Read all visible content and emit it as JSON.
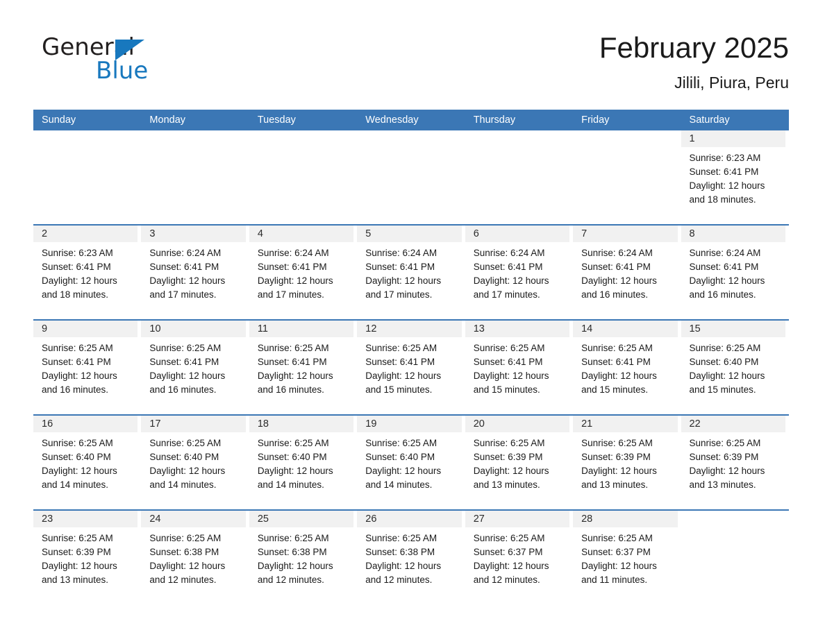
{
  "brand": {
    "name_part1": "General",
    "name_part2": "Blue",
    "logo_icon": "triangle-flag-icon",
    "blue": "#1878be"
  },
  "header": {
    "title": "February 2025",
    "subtitle": "Jilili, Piura, Peru"
  },
  "theme": {
    "header_blue": "#3b77b5",
    "day_strip_gray": "#f1f1f1",
    "text": "#1a1a1a"
  },
  "weekdays": [
    "Sunday",
    "Monday",
    "Tuesday",
    "Wednesday",
    "Thursday",
    "Friday",
    "Saturday"
  ],
  "weeks": [
    [
      {
        "day": "",
        "sunrise": "",
        "sunset": "",
        "daylight1": "",
        "daylight2": ""
      },
      {
        "day": "",
        "sunrise": "",
        "sunset": "",
        "daylight1": "",
        "daylight2": ""
      },
      {
        "day": "",
        "sunrise": "",
        "sunset": "",
        "daylight1": "",
        "daylight2": ""
      },
      {
        "day": "",
        "sunrise": "",
        "sunset": "",
        "daylight1": "",
        "daylight2": ""
      },
      {
        "day": "",
        "sunrise": "",
        "sunset": "",
        "daylight1": "",
        "daylight2": ""
      },
      {
        "day": "",
        "sunrise": "",
        "sunset": "",
        "daylight1": "",
        "daylight2": ""
      },
      {
        "day": "1",
        "sunrise": "Sunrise: 6:23 AM",
        "sunset": "Sunset: 6:41 PM",
        "daylight1": "Daylight: 12 hours",
        "daylight2": "and 18 minutes."
      }
    ],
    [
      {
        "day": "2",
        "sunrise": "Sunrise: 6:23 AM",
        "sunset": "Sunset: 6:41 PM",
        "daylight1": "Daylight: 12 hours",
        "daylight2": "and 18 minutes."
      },
      {
        "day": "3",
        "sunrise": "Sunrise: 6:24 AM",
        "sunset": "Sunset: 6:41 PM",
        "daylight1": "Daylight: 12 hours",
        "daylight2": "and 17 minutes."
      },
      {
        "day": "4",
        "sunrise": "Sunrise: 6:24 AM",
        "sunset": "Sunset: 6:41 PM",
        "daylight1": "Daylight: 12 hours",
        "daylight2": "and 17 minutes."
      },
      {
        "day": "5",
        "sunrise": "Sunrise: 6:24 AM",
        "sunset": "Sunset: 6:41 PM",
        "daylight1": "Daylight: 12 hours",
        "daylight2": "and 17 minutes."
      },
      {
        "day": "6",
        "sunrise": "Sunrise: 6:24 AM",
        "sunset": "Sunset: 6:41 PM",
        "daylight1": "Daylight: 12 hours",
        "daylight2": "and 17 minutes."
      },
      {
        "day": "7",
        "sunrise": "Sunrise: 6:24 AM",
        "sunset": "Sunset: 6:41 PM",
        "daylight1": "Daylight: 12 hours",
        "daylight2": "and 16 minutes."
      },
      {
        "day": "8",
        "sunrise": "Sunrise: 6:24 AM",
        "sunset": "Sunset: 6:41 PM",
        "daylight1": "Daylight: 12 hours",
        "daylight2": "and 16 minutes."
      }
    ],
    [
      {
        "day": "9",
        "sunrise": "Sunrise: 6:25 AM",
        "sunset": "Sunset: 6:41 PM",
        "daylight1": "Daylight: 12 hours",
        "daylight2": "and 16 minutes."
      },
      {
        "day": "10",
        "sunrise": "Sunrise: 6:25 AM",
        "sunset": "Sunset: 6:41 PM",
        "daylight1": "Daylight: 12 hours",
        "daylight2": "and 16 minutes."
      },
      {
        "day": "11",
        "sunrise": "Sunrise: 6:25 AM",
        "sunset": "Sunset: 6:41 PM",
        "daylight1": "Daylight: 12 hours",
        "daylight2": "and 16 minutes."
      },
      {
        "day": "12",
        "sunrise": "Sunrise: 6:25 AM",
        "sunset": "Sunset: 6:41 PM",
        "daylight1": "Daylight: 12 hours",
        "daylight2": "and 15 minutes."
      },
      {
        "day": "13",
        "sunrise": "Sunrise: 6:25 AM",
        "sunset": "Sunset: 6:41 PM",
        "daylight1": "Daylight: 12 hours",
        "daylight2": "and 15 minutes."
      },
      {
        "day": "14",
        "sunrise": "Sunrise: 6:25 AM",
        "sunset": "Sunset: 6:41 PM",
        "daylight1": "Daylight: 12 hours",
        "daylight2": "and 15 minutes."
      },
      {
        "day": "15",
        "sunrise": "Sunrise: 6:25 AM",
        "sunset": "Sunset: 6:40 PM",
        "daylight1": "Daylight: 12 hours",
        "daylight2": "and 15 minutes."
      }
    ],
    [
      {
        "day": "16",
        "sunrise": "Sunrise: 6:25 AM",
        "sunset": "Sunset: 6:40 PM",
        "daylight1": "Daylight: 12 hours",
        "daylight2": "and 14 minutes."
      },
      {
        "day": "17",
        "sunrise": "Sunrise: 6:25 AM",
        "sunset": "Sunset: 6:40 PM",
        "daylight1": "Daylight: 12 hours",
        "daylight2": "and 14 minutes."
      },
      {
        "day": "18",
        "sunrise": "Sunrise: 6:25 AM",
        "sunset": "Sunset: 6:40 PM",
        "daylight1": "Daylight: 12 hours",
        "daylight2": "and 14 minutes."
      },
      {
        "day": "19",
        "sunrise": "Sunrise: 6:25 AM",
        "sunset": "Sunset: 6:40 PM",
        "daylight1": "Daylight: 12 hours",
        "daylight2": "and 14 minutes."
      },
      {
        "day": "20",
        "sunrise": "Sunrise: 6:25 AM",
        "sunset": "Sunset: 6:39 PM",
        "daylight1": "Daylight: 12 hours",
        "daylight2": "and 13 minutes."
      },
      {
        "day": "21",
        "sunrise": "Sunrise: 6:25 AM",
        "sunset": "Sunset: 6:39 PM",
        "daylight1": "Daylight: 12 hours",
        "daylight2": "and 13 minutes."
      },
      {
        "day": "22",
        "sunrise": "Sunrise: 6:25 AM",
        "sunset": "Sunset: 6:39 PM",
        "daylight1": "Daylight: 12 hours",
        "daylight2": "and 13 minutes."
      }
    ],
    [
      {
        "day": "23",
        "sunrise": "Sunrise: 6:25 AM",
        "sunset": "Sunset: 6:39 PM",
        "daylight1": "Daylight: 12 hours",
        "daylight2": "and 13 minutes."
      },
      {
        "day": "24",
        "sunrise": "Sunrise: 6:25 AM",
        "sunset": "Sunset: 6:38 PM",
        "daylight1": "Daylight: 12 hours",
        "daylight2": "and 12 minutes."
      },
      {
        "day": "25",
        "sunrise": "Sunrise: 6:25 AM",
        "sunset": "Sunset: 6:38 PM",
        "daylight1": "Daylight: 12 hours",
        "daylight2": "and 12 minutes."
      },
      {
        "day": "26",
        "sunrise": "Sunrise: 6:25 AM",
        "sunset": "Sunset: 6:38 PM",
        "daylight1": "Daylight: 12 hours",
        "daylight2": "and 12 minutes."
      },
      {
        "day": "27",
        "sunrise": "Sunrise: 6:25 AM",
        "sunset": "Sunset: 6:37 PM",
        "daylight1": "Daylight: 12 hours",
        "daylight2": "and 12 minutes."
      },
      {
        "day": "28",
        "sunrise": "Sunrise: 6:25 AM",
        "sunset": "Sunset: 6:37 PM",
        "daylight1": "Daylight: 12 hours",
        "daylight2": "and 11 minutes."
      },
      {
        "day": "",
        "sunrise": "",
        "sunset": "",
        "daylight1": "",
        "daylight2": ""
      }
    ]
  ]
}
